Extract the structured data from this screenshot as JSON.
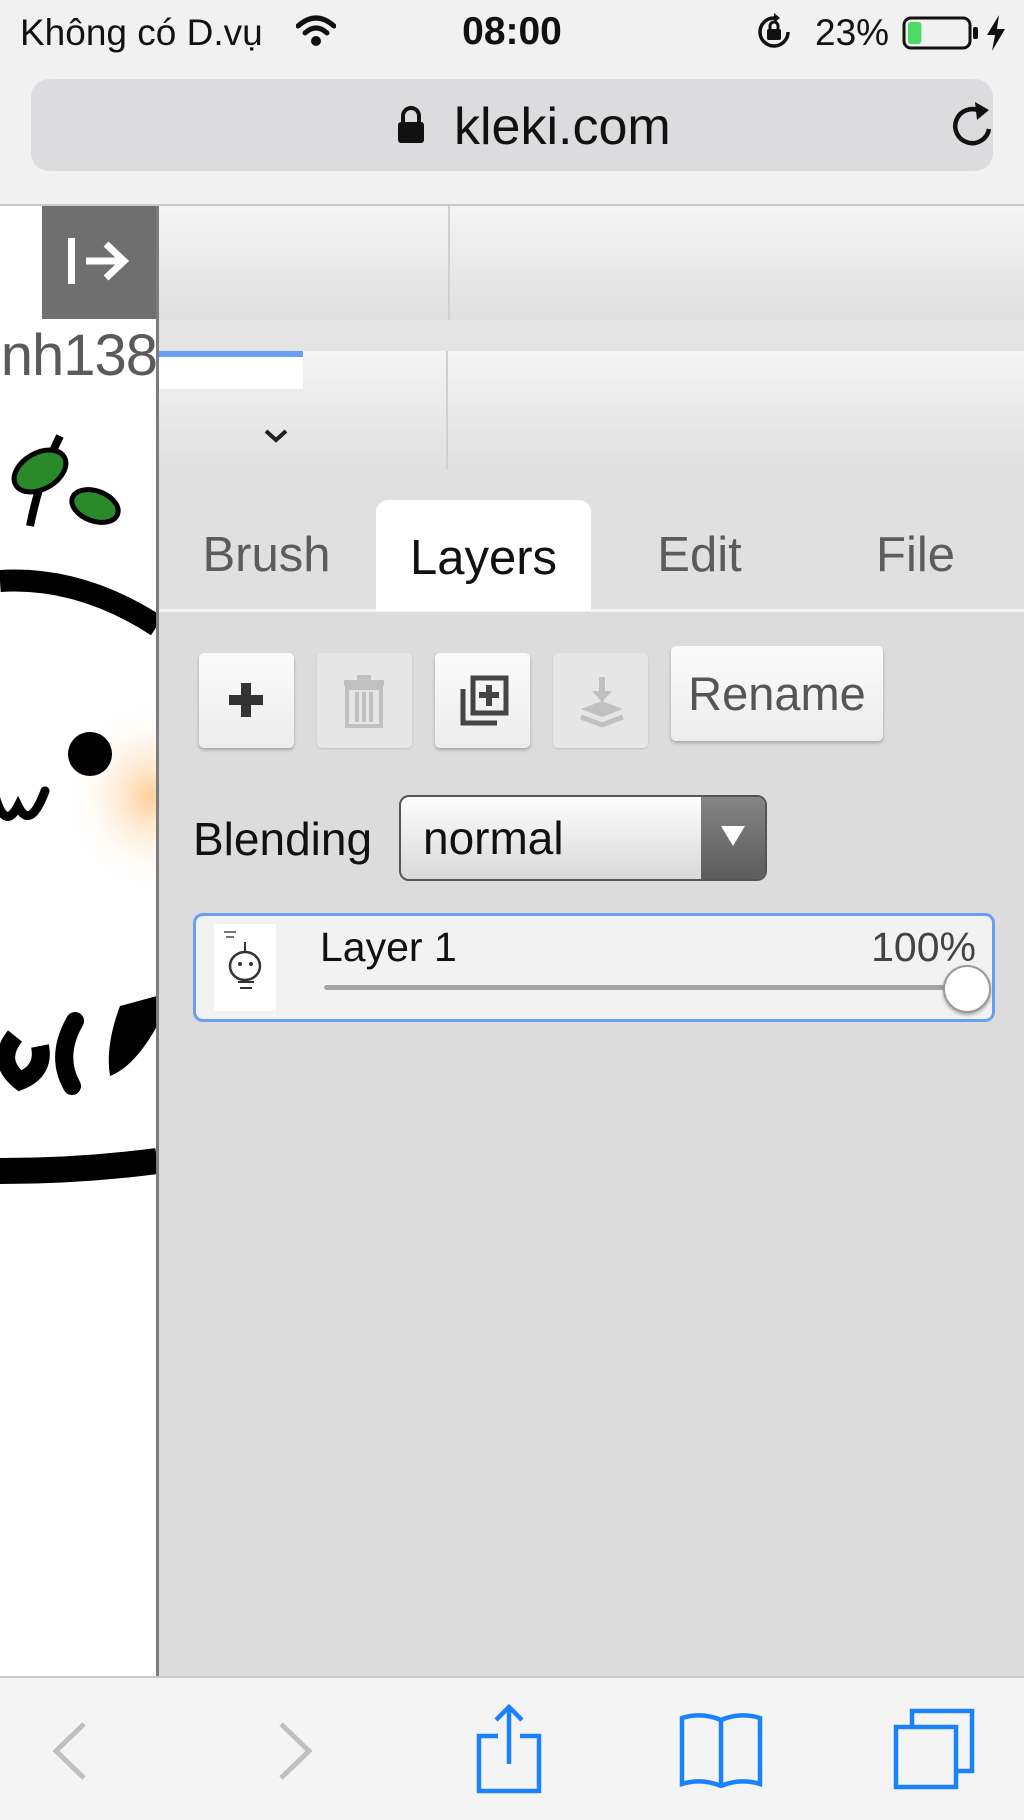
{
  "status_bar": {
    "carrier": "Không có D.vụ",
    "time": "08:00",
    "battery_percent": "23%",
    "battery_level": 0.23,
    "battery_color": "#4cd964"
  },
  "browser": {
    "url": "kleki.com",
    "accent": "#1a82fb"
  },
  "canvas": {
    "username_fragment": "nh138"
  },
  "panel": {
    "tabs": [
      {
        "label": "Brush",
        "active": false
      },
      {
        "label": "Layers",
        "active": true
      },
      {
        "label": "Edit",
        "active": false
      },
      {
        "label": "File",
        "active": false
      }
    ],
    "layer_tools": {
      "rename_label": "Rename"
    },
    "blending": {
      "label": "Blending",
      "value": "normal"
    },
    "layers": [
      {
        "name": "Layer 1",
        "opacity_label": "100%",
        "opacity": 1.0,
        "selected": true
      }
    ],
    "selection_color": "#6a9ef2"
  }
}
